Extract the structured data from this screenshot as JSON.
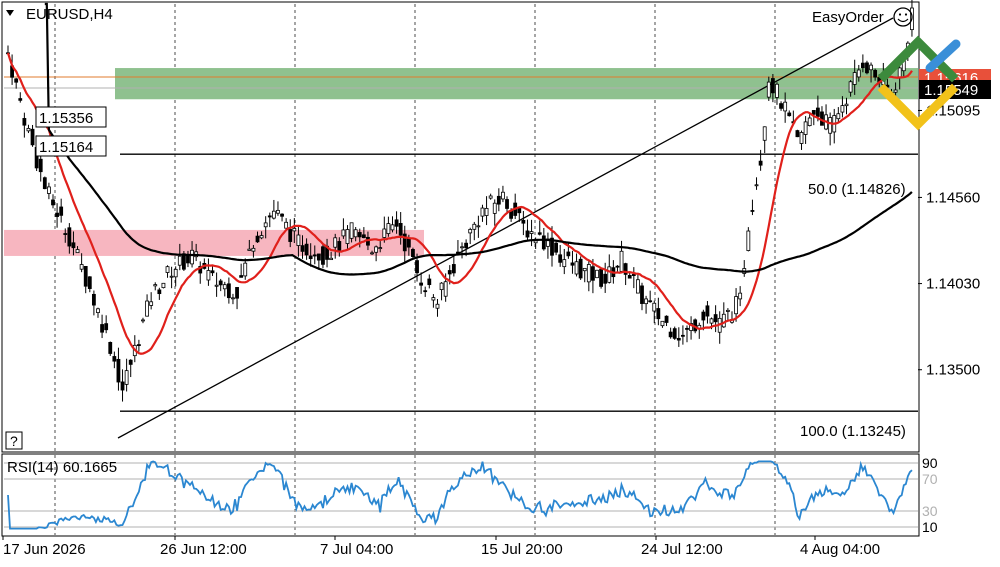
{
  "symbol_title": "EURUSD,H4",
  "easy_order_label": "EasyOrder",
  "help_button_label": "?",
  "colors": {
    "background": "#ffffff",
    "candle": "#000000",
    "ma_fast": "#e0201b",
    "ma_slow": "#000000",
    "resistance_zone": "#8fc18f",
    "support_zone": "#f7b6c0",
    "rsi_line": "#2b87d1",
    "current_price_line": "#e07b2e",
    "logo_green": "#3c8a3c",
    "logo_yellow": "#f2c21a",
    "logo_blue": "#3a8fd8",
    "grid": "#000000"
  },
  "chart_data": {
    "type": "candlestick",
    "price_axis": {
      "ticks": [
        "1.15095",
        "1.14560",
        "1.14030",
        "1.13500"
      ],
      "range": [
        1.13,
        1.1575
      ]
    },
    "time_axis": {
      "ticks": [
        "17 Jun 2026",
        "26 Jun 12:00",
        "7 Jul 04:00",
        "15 Jul 20:00",
        "24 Jul 12:00",
        "4 Aug 04:00"
      ]
    },
    "zone_labels": {
      "resistance_top": "1.15356",
      "resistance_bottom": "1.15164"
    },
    "zones": {
      "resistance": [
        1.15164,
        1.15356
      ],
      "support": [
        1.142,
        1.1436
      ]
    },
    "fibonacci": [
      {
        "label": "50.0 (1.14826)",
        "level": 1.14826
      },
      {
        "label": "100.0 (1.13245)",
        "level": 1.13245
      }
    ],
    "current_price": {
      "bid": "1.15549",
      "ask": "1.15616"
    },
    "rsi": {
      "title": "RSI(14) 60.1665",
      "levels": [
        "90",
        "70",
        "30",
        "10"
      ],
      "range": [
        0,
        100
      ]
    }
  }
}
